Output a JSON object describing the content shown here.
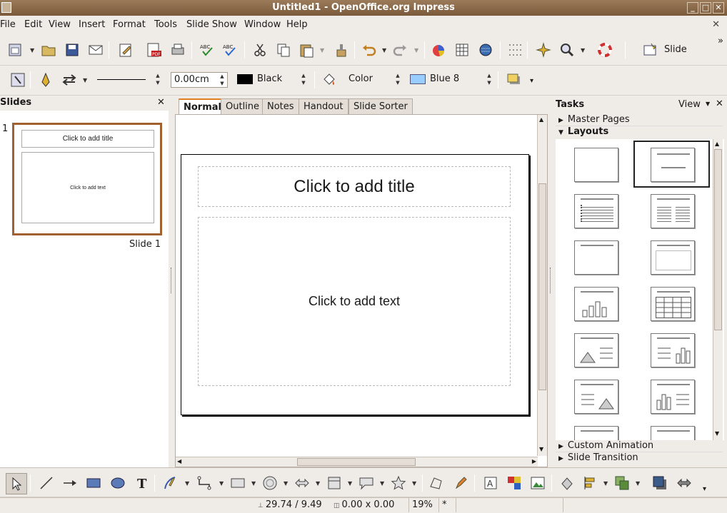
{
  "window": {
    "title": "Untitled1 - OpenOffice.org Impress"
  },
  "menu": [
    "File",
    "Edit",
    "View",
    "Insert",
    "Format",
    "Tools",
    "Slide Show",
    "Window",
    "Help"
  ],
  "toolbar1": {
    "slide_button_label": "Slide"
  },
  "toolbar2": {
    "line_width_value": "0.00cm",
    "line_color_value": "Black",
    "area_style_value": "Color",
    "area_color_value": "Blue 8",
    "colors": {
      "black": "#000000",
      "blue8": "#99ccff"
    }
  },
  "slides_panel": {
    "title": "Slides",
    "slide_number": "1",
    "thumb_title": "Click to add title",
    "thumb_text": "Click to add text",
    "slide_label": "Slide 1"
  },
  "tabs": [
    "Normal",
    "Outline",
    "Notes",
    "Handout",
    "Slide Sorter"
  ],
  "slide": {
    "title_placeholder": "Click to add title",
    "text_placeholder": "Click to add text"
  },
  "tasks_panel": {
    "title": "Tasks",
    "view_label": "View",
    "sections": {
      "master_pages": "Master Pages",
      "layouts": "Layouts",
      "custom_animation": "Custom Animation",
      "slide_transition": "Slide Transition"
    }
  },
  "status": {
    "position": "29.74 / 9.49",
    "size": "0.00 x 0.00",
    "zoom": "19%",
    "modified": "*"
  },
  "accent_color": "#e07f20"
}
